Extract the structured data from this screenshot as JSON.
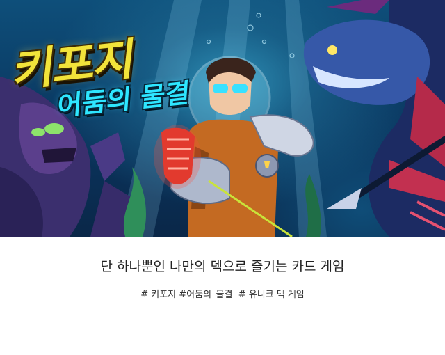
{
  "banner": {
    "logo_title": "키포지",
    "logo_subtitle": "어둠의 물결"
  },
  "tagline": "단 하나뿐인 나만의 덱으로 즐기는 카드 게임",
  "hashtags": "# 키포지 #어둠의_물결  # 유니크 덱 게임",
  "colors": {
    "ocean_deep": "#0a2748",
    "ocean_light": "#2e8fb5",
    "logo_yellow": "#f2e33a",
    "logo_cyan": "#2ee6ff"
  }
}
